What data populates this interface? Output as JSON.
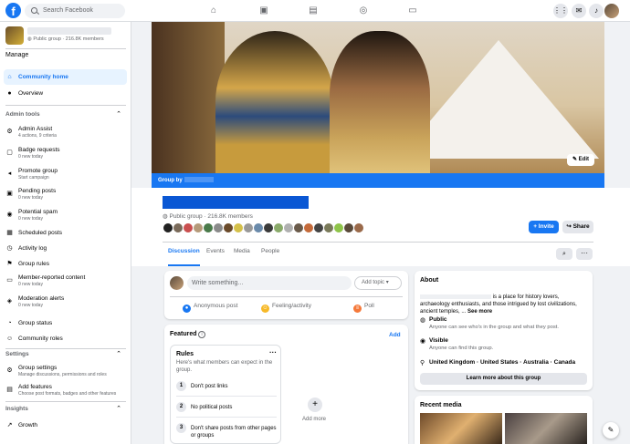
{
  "topbar": {
    "search_placeholder": "Search Facebook",
    "nav_icons": [
      "home-icon",
      "video-icon",
      "marketplace-icon",
      "groups-icon",
      "gaming-icon"
    ],
    "right_icons": [
      "menu-grid-icon",
      "messenger-icon",
      "notifications-icon"
    ]
  },
  "sidebar": {
    "group_meta": "Public group · 216.8K members",
    "manage_label": "Manage",
    "items_top": [
      {
        "label": "Community home",
        "icon": "home-icon",
        "active": true
      },
      {
        "label": "Overview",
        "icon": "overview-icon"
      }
    ],
    "admin_tools_label": "Admin tools",
    "admin_items": [
      {
        "label": "Admin Assist",
        "sub": "4 actions, 9 criteria",
        "icon": "admin-assist-icon"
      },
      {
        "label": "Badge requests",
        "sub": "0 new today",
        "icon": "badge-icon"
      },
      {
        "label": "Promote group",
        "sub": "Start campaign",
        "icon": "megaphone-icon"
      },
      {
        "label": "Pending posts",
        "sub": "0 new today",
        "icon": "pending-icon"
      },
      {
        "label": "Potential spam",
        "sub": "0 new today",
        "icon": "spam-icon"
      },
      {
        "label": "Scheduled posts",
        "sub": "",
        "icon": "calendar-icon"
      },
      {
        "label": "Activity log",
        "sub": "",
        "icon": "clock-icon"
      },
      {
        "label": "Group rules",
        "sub": "",
        "icon": "rules-icon"
      },
      {
        "label": "Member-reported content",
        "sub": "0 new today",
        "icon": "report-icon"
      },
      {
        "label": "Moderation alerts",
        "sub": "0 new today",
        "icon": "alert-icon"
      },
      {
        "label": "Group status",
        "sub": "",
        "icon": "status-icon"
      },
      {
        "label": "Community roles",
        "sub": "",
        "icon": "roles-icon"
      }
    ],
    "settings_label": "Settings",
    "settings_items": [
      {
        "label": "Group settings",
        "sub": "Manage discussions, permissions and roles",
        "icon": "settings-icon"
      },
      {
        "label": "Add features",
        "sub": "Choose post formats, badges and other features",
        "icon": "features-icon"
      }
    ],
    "insights_label": "Insights",
    "insights_items": [
      {
        "label": "Growth",
        "sub": "",
        "icon": "growth-icon"
      }
    ]
  },
  "cover": {
    "edit_label": "Edit",
    "group_by_label": "Group by"
  },
  "header": {
    "meta": "Public group · 216.8K members",
    "invite_label": "+ Invite",
    "share_label": "Share",
    "tabs": [
      "Discussion",
      "Events",
      "Media",
      "People"
    ],
    "active_tab": "Discussion"
  },
  "composer": {
    "placeholder": "Write something...",
    "add_topic": "Add topic",
    "actions": [
      {
        "label": "Anonymous post",
        "color": "#1877f2"
      },
      {
        "label": "Feeling/activity",
        "color": "#f7b928"
      },
      {
        "label": "Poll",
        "color": "#f5793a"
      }
    ]
  },
  "featured": {
    "title": "Featured",
    "add_label": "Add",
    "rules_title": "Rules",
    "rules_sub": "Here's what members can expect in the group.",
    "rules": [
      {
        "num": "1",
        "text": "Don't post links"
      },
      {
        "num": "2",
        "text": "No political posts"
      },
      {
        "num": "3",
        "text": "Don't share posts from other pages or groups"
      }
    ],
    "add_more": "Add more"
  },
  "about": {
    "title": "About",
    "desc_tail": "is a place for history lovers, archaeology enthusiasts, and those intrigued by lost civilizations, ancient temples, ...",
    "see_more": "See more",
    "public_title": "Public",
    "public_desc": "Anyone can see who's in the group and what they post.",
    "visible_title": "Visible",
    "visible_desc": "Anyone can find this group.",
    "locations": "United Kingdom · United States · Australia · Canada",
    "learn_more": "Learn more about this group"
  },
  "recent_media": {
    "title": "Recent media"
  },
  "colors": {
    "accent": "#1877f2",
    "title_redaction": "#0a57d4"
  }
}
